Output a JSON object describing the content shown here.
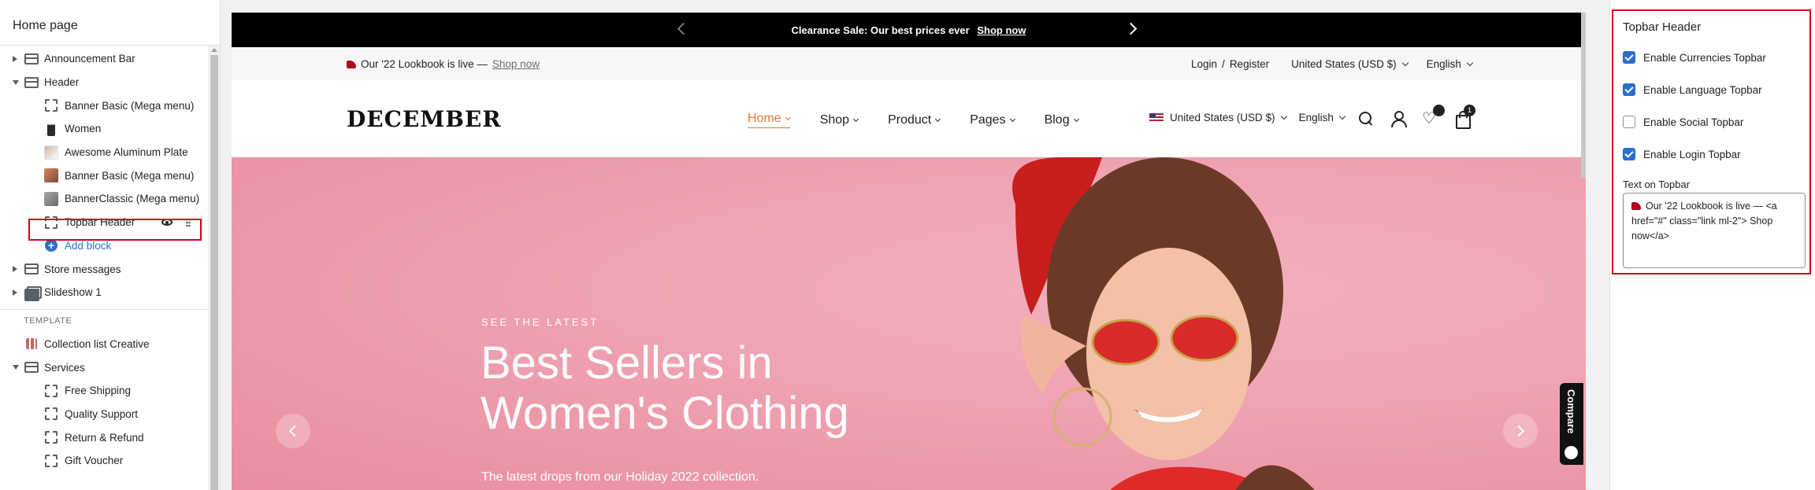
{
  "sidebar": {
    "title": "Home page",
    "items": [
      {
        "label": "Announcement Bar"
      },
      {
        "label": "Header"
      },
      {
        "label": "Banner Basic (Mega menu)"
      },
      {
        "label": "Women"
      },
      {
        "label": "Awesome Aluminum Plate"
      },
      {
        "label": "Banner Basic (Mega menu)"
      },
      {
        "label": "BannerClassic (Mega menu)"
      },
      {
        "label": "Topbar Header"
      },
      {
        "label": "Add block"
      },
      {
        "label": "Store messages"
      },
      {
        "label": "Slideshow 1"
      }
    ],
    "template_label": "TEMPLATE",
    "template_items": [
      {
        "label": "Collection list Creative"
      },
      {
        "label": "Services"
      },
      {
        "label": "Free Shipping"
      },
      {
        "label": "Quality Support"
      },
      {
        "label": "Return & Refund"
      },
      {
        "label": "Gift Voucher"
      }
    ]
  },
  "preview": {
    "announcement": {
      "text": "Clearance Sale: Our best prices ever",
      "link": "Shop now"
    },
    "topbar": {
      "lookbook": "Our '22 Lookbook is live —",
      "lookbook_link": "Shop now",
      "login": "Login",
      "sep": "/",
      "register": "Register",
      "currency": "United States (USD $)",
      "language": "English"
    },
    "header": {
      "logo": "DECEMBER",
      "nav": [
        "Home",
        "Shop",
        "Product",
        "Pages",
        "Blog"
      ],
      "currency": "United States (USD $)",
      "language": "English",
      "cart_count": "1"
    },
    "hero": {
      "subtitle": "SEE THE LATEST",
      "title_line1": "Best Sellers in",
      "title_line2": "Women's Clothing",
      "description": "The latest drops from our Holiday 2022 collection."
    },
    "compare": "Compare"
  },
  "settings": {
    "title": "Topbar Header",
    "options": [
      {
        "label": "Enable Currencies Topbar",
        "checked": true
      },
      {
        "label": "Enable Language Topbar",
        "checked": true
      },
      {
        "label": "Enable Social Topbar",
        "checked": false
      },
      {
        "label": "Enable Login Topbar",
        "checked": true
      }
    ],
    "text_label": "Text on Topbar",
    "text_value": "Our '22 Lookbook is live — <a href=\"#\" class=\"link ml-2\"> Shop now</a>"
  },
  "colors": {
    "accent": "#2c6ecb",
    "highlight": "#d0021b",
    "nav_active": "#e0733b",
    "hero_bg": "#ee9eae"
  }
}
